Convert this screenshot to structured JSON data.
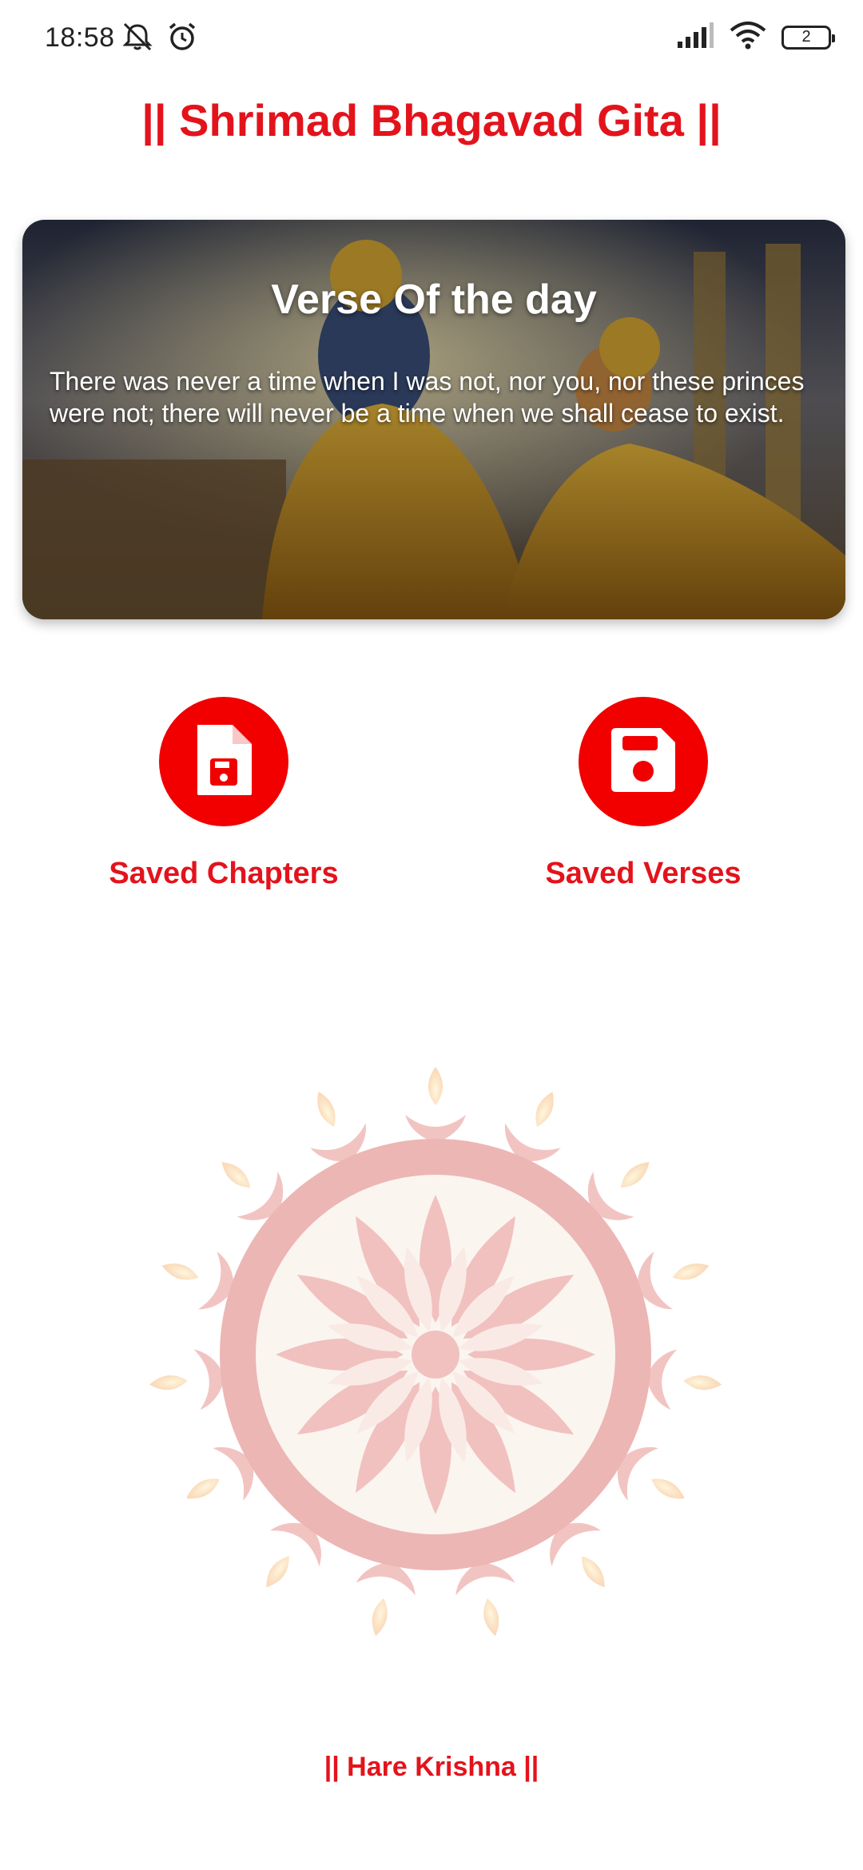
{
  "status_bar": {
    "time": "18:58",
    "battery_level": "2",
    "icons": [
      "mute-icon",
      "alarm-icon",
      "signal-icon",
      "wifi-icon",
      "battery-icon"
    ]
  },
  "header": {
    "title": "|| Shrimad Bhagavad Gita ||"
  },
  "verse_of_day": {
    "heading": "Verse Of the day",
    "text": "There was never a time when I was not, nor you, nor these princes were not; there will never be a time when we shall cease to exist."
  },
  "actions": [
    {
      "label": "Saved Chapters",
      "icon": "saved-file-icon"
    },
    {
      "label": "Saved Verses",
      "icon": "floppy-disk-icon"
    }
  ],
  "footer": {
    "text": "|| Hare Krishna ||"
  },
  "colors": {
    "accent": "#e3131c",
    "button": "#f20000",
    "background": "#ffffff"
  }
}
